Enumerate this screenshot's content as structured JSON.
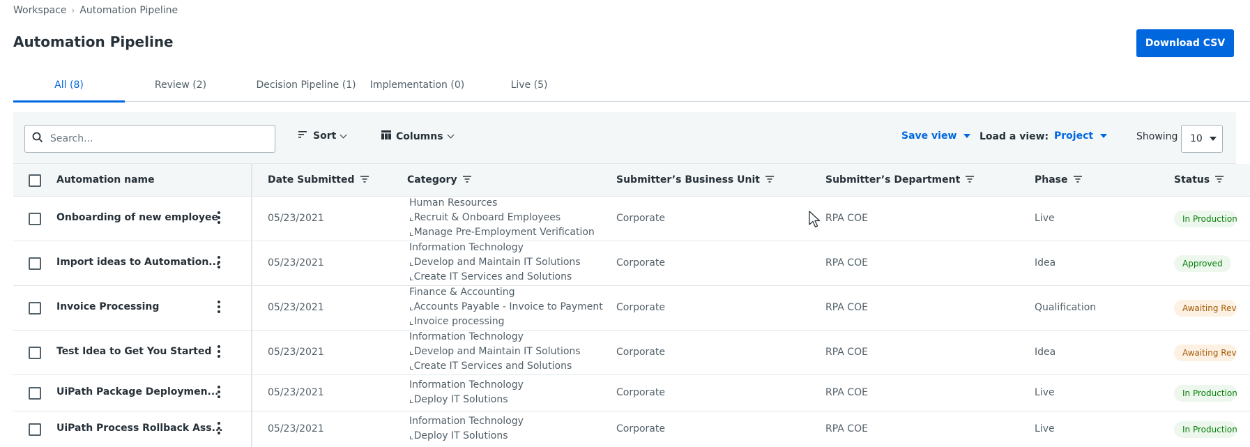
{
  "breadcrumb": {
    "root": "Workspace",
    "current": "Automation Pipeline"
  },
  "page": {
    "title": "Automation Pipeline",
    "download_label": "Download CSV"
  },
  "colors": {
    "accent": "#0067df",
    "status_green": "#038108",
    "status_orange": "#a35c06"
  },
  "tabs": [
    {
      "label": "All (8)",
      "active": true
    },
    {
      "label": "Review (2)",
      "active": false
    },
    {
      "label": "Decision Pipeline (1)",
      "active": false
    },
    {
      "label": "Implementation (0)",
      "active": false
    },
    {
      "label": "Live (5)",
      "active": false
    }
  ],
  "toolbar": {
    "search_placeholder": "Search...",
    "sort_label": "Sort",
    "columns_label": "Columns",
    "save_view_label": "Save view",
    "load_view_label": "Load a view:",
    "load_view_value": "Project",
    "showing_label": "Showing",
    "showing_value": "10"
  },
  "table": {
    "columns": {
      "name": "Automation name",
      "date": "Date Submitted",
      "category": "Category",
      "business_unit": "Submitter’s Business Unit",
      "department": "Submitter’s Department",
      "phase": "Phase",
      "status": "Status"
    },
    "rows": [
      {
        "name": "Onboarding of new employee",
        "date": "05/23/2021",
        "category": [
          "Human Resources",
          "Recruit & Onboard Employees",
          "Manage Pre-Employment Verification"
        ],
        "business_unit": "Corporate",
        "department": "RPA COE",
        "phase": "Live",
        "status": "In Production",
        "status_tone": "green"
      },
      {
        "name": "Import ideas to Automation...",
        "date": "05/23/2021",
        "category": [
          "Information Technology",
          "Develop and Maintain IT Solutions",
          "Create IT Services and Solutions"
        ],
        "business_unit": "Corporate",
        "department": "RPA COE",
        "phase": "Idea",
        "status": "Approved",
        "status_tone": "approved"
      },
      {
        "name": "Invoice Processing",
        "date": "05/23/2021",
        "category": [
          "Finance & Accounting",
          "Accounts Payable - Invoice to Payment",
          "Invoice processing"
        ],
        "business_unit": "Corporate",
        "department": "RPA COE",
        "phase": "Qualification",
        "status": "Awaiting Review",
        "status_tone": "orange"
      },
      {
        "name": "Test Idea to Get You Started",
        "date": "05/23/2021",
        "category": [
          "Information Technology",
          "Develop and Maintain IT Solutions",
          "Create IT Services and Solutions"
        ],
        "business_unit": "Corporate",
        "department": "RPA COE",
        "phase": "Idea",
        "status": "Awaiting Review",
        "status_tone": "orange"
      },
      {
        "name": "UiPath Package Deploymen...",
        "date": "05/23/2021",
        "category": [
          "Information Technology",
          "Deploy IT Solutions"
        ],
        "business_unit": "Corporate",
        "department": "RPA COE",
        "phase": "Live",
        "status": "In Production",
        "status_tone": "green"
      },
      {
        "name": "UiPath Process Rollback Ass...",
        "date": "05/23/2021",
        "category": [
          "Information Technology",
          "Deploy IT Solutions"
        ],
        "business_unit": "Corporate",
        "department": "RPA COE",
        "phase": "Live",
        "status": "In Production",
        "status_tone": "green"
      }
    ]
  }
}
